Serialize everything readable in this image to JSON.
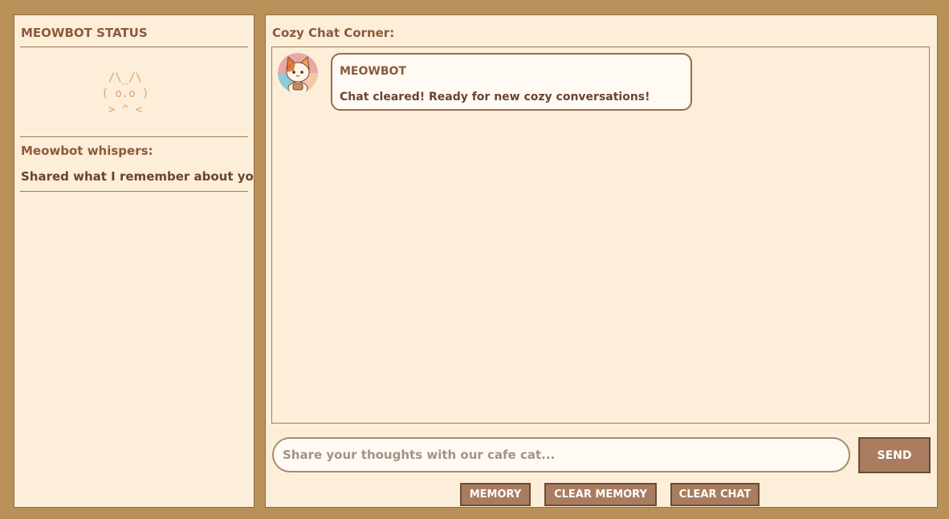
{
  "status_panel": {
    "title": "MEOWBOT STATUS",
    "cat_art": {
      "ears": "/\\_/\\",
      "face": "( o.o )",
      "mouth": "> ^ <"
    },
    "whispers_label": "Meowbot whispers:",
    "whispers_text": "Shared what I remember about you"
  },
  "chat_panel": {
    "title": "Cozy Chat Corner:",
    "messages": [
      {
        "sender": "MEOWBOT",
        "text": "Chat cleared! Ready for new cozy conversations!",
        "avatar_icon": "cat-avatar-icon"
      }
    ],
    "input": {
      "value": "",
      "placeholder": "Share your thoughts with our cafe cat..."
    },
    "send_label": "SEND",
    "buttons": {
      "memory": "MEMORY",
      "clear_memory": "CLEAR MEMORY",
      "clear_chat": "CLEAR CHAT"
    }
  },
  "colors": {
    "background": "#b89159",
    "panel": "#fdeed9",
    "heading_text": "#8b5a3c",
    "body_text": "#6b4430",
    "ascii_art": "#dda06b",
    "button": "#a97c60",
    "button_border": "#6b4c34"
  }
}
